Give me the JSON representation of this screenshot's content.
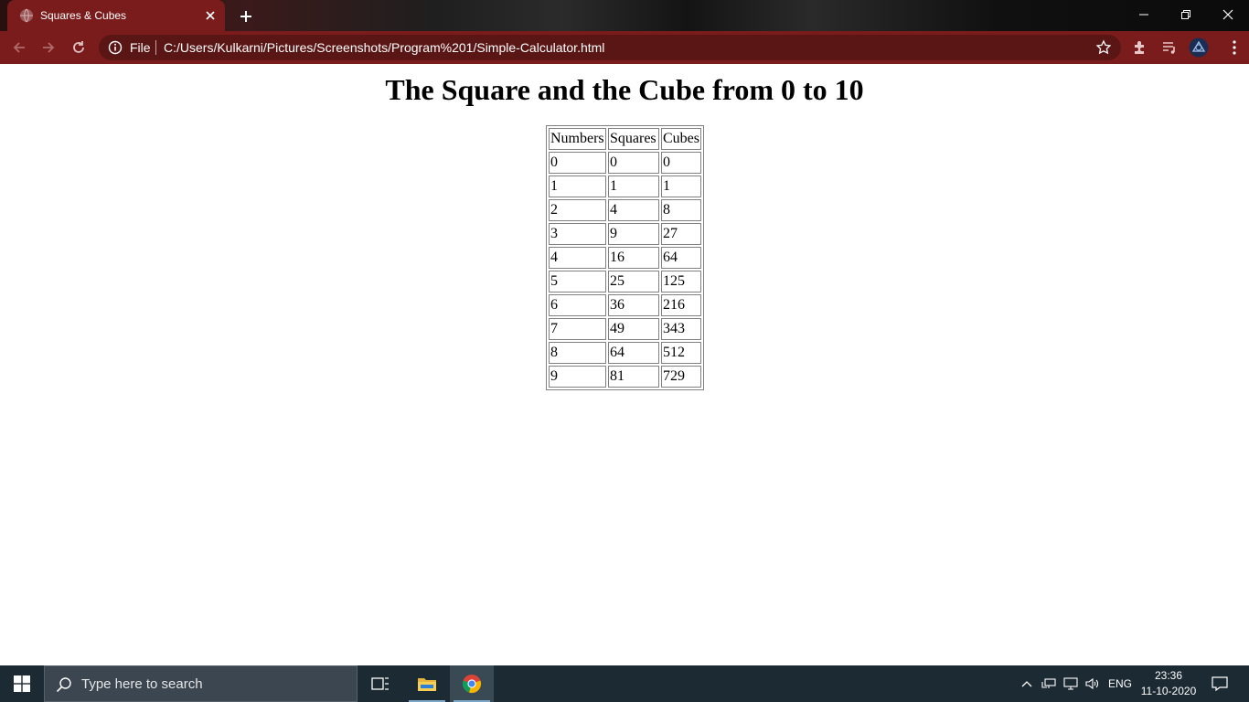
{
  "browser": {
    "tab_title": "Squares & Cubes",
    "address": {
      "scheme_label": "File",
      "url": "C:/Users/Kulkarni/Pictures/Screenshots/Program%201/Simple-Calculator.html"
    },
    "colors": {
      "frame": "#7a1c1c",
      "omnibox": "#5a1515"
    }
  },
  "page": {
    "heading": "The Square and the Cube from 0 to 10",
    "table": {
      "headers": [
        "Numbers",
        "Squares",
        "Cubes"
      ],
      "rows": [
        [
          "0",
          "0",
          "0"
        ],
        [
          "1",
          "1",
          "1"
        ],
        [
          "2",
          "4",
          "8"
        ],
        [
          "3",
          "9",
          "27"
        ],
        [
          "4",
          "16",
          "64"
        ],
        [
          "5",
          "25",
          "125"
        ],
        [
          "6",
          "36",
          "216"
        ],
        [
          "7",
          "49",
          "343"
        ],
        [
          "8",
          "64",
          "512"
        ],
        [
          "9",
          "81",
          "729"
        ]
      ]
    }
  },
  "taskbar": {
    "search_placeholder": "Type here to search",
    "language": "ENG",
    "time": "23:36",
    "date": "11-10-2020",
    "colors": {
      "background": "#1c2a33",
      "search": "#3b4650"
    }
  }
}
